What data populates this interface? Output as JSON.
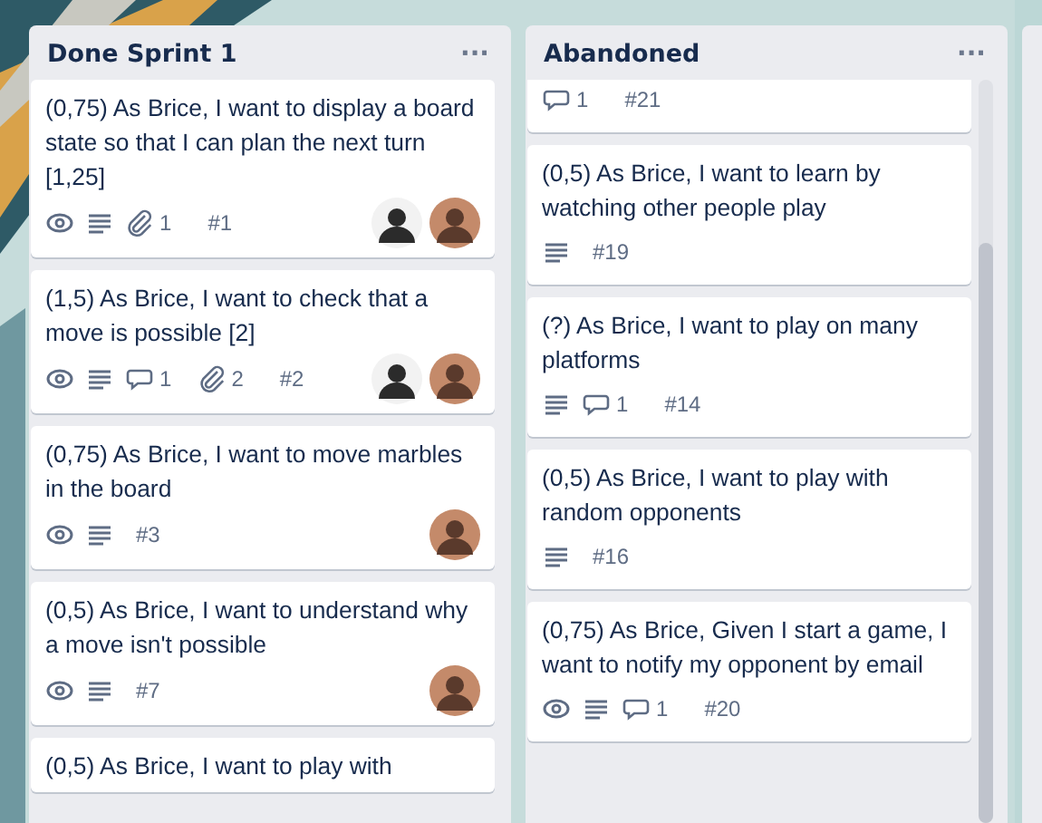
{
  "lists": [
    {
      "title": "Done Sprint 1",
      "menu": "···",
      "cards": [
        {
          "title": "(0,75) As Brice, I want to display a board state so that I can plan the next turn [1,25]",
          "badges": [
            {
              "kind": "watch"
            },
            {
              "kind": "description"
            },
            {
              "kind": "attachment",
              "count": "1"
            }
          ],
          "number": "#1",
          "avatars": [
            {
              "kind": "panda"
            },
            {
              "kind": "person"
            }
          ]
        },
        {
          "title": "(1,5) As Brice, I want to check that a move is possible [2]",
          "badges": [
            {
              "kind": "watch"
            },
            {
              "kind": "description"
            },
            {
              "kind": "comment",
              "count": "1"
            },
            {
              "kind": "attachment",
              "count": "2"
            }
          ],
          "number": "#2",
          "avatars": [
            {
              "kind": "panda"
            },
            {
              "kind": "person"
            }
          ]
        },
        {
          "title": "(0,75) As Brice, I want to move marbles in the board",
          "badges": [
            {
              "kind": "watch"
            },
            {
              "kind": "description"
            }
          ],
          "number": "#3",
          "avatars": [
            {
              "kind": "person"
            }
          ]
        },
        {
          "title": "(0,5) As Brice, I want to understand why a move isn't possible",
          "badges": [
            {
              "kind": "watch"
            },
            {
              "kind": "description"
            }
          ],
          "number": "#7",
          "avatars": [
            {
              "kind": "person"
            }
          ]
        },
        {
          "title": "(0,5) As Brice, I want to play with"
        }
      ]
    },
    {
      "title": "Abandoned",
      "menu": "···",
      "scrollbar": true,
      "cards": [
        {
          "badges": [
            {
              "kind": "comment",
              "count": "1"
            }
          ],
          "number": "#21"
        },
        {
          "title": "(0,5) As Brice, I want to learn by watching other people play",
          "badges": [
            {
              "kind": "description"
            }
          ],
          "number": "#19"
        },
        {
          "title": "(?) As Brice, I want to play on many platforms",
          "badges": [
            {
              "kind": "description"
            },
            {
              "kind": "comment",
              "count": "1"
            }
          ],
          "number": "#14"
        },
        {
          "title": "(0,5) As Brice, I want to play with random opponents",
          "badges": [
            {
              "kind": "description"
            }
          ],
          "number": "#16"
        },
        {
          "title": "(0,75) As Brice, Given I start a game, I want to notify my opponent by email",
          "badges": [
            {
              "kind": "watch"
            },
            {
              "kind": "description"
            },
            {
              "kind": "comment",
              "count": "1"
            }
          ],
          "number": "#20"
        }
      ]
    }
  ]
}
